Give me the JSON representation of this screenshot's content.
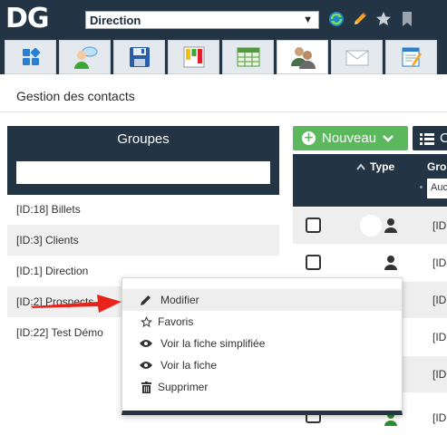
{
  "app": {
    "logo": "DG",
    "group_select": {
      "value": "Direction"
    }
  },
  "header": {
    "icons": [
      "refresh-icon",
      "pencil-icon",
      "star-icon",
      "bookmark-icon"
    ]
  },
  "toolbar": {
    "tabs": [
      {
        "icon": "modules-icon"
      },
      {
        "icon": "user-chat-icon"
      },
      {
        "icon": "floppy-disk-icon"
      },
      {
        "icon": "kanban-board-icon"
      },
      {
        "icon": "table-grid-icon"
      },
      {
        "icon": "contacts-icon",
        "active": true
      },
      {
        "icon": "envelope-icon"
      },
      {
        "icon": "notepad-icon"
      }
    ]
  },
  "page": {
    "title": "Gestion des contacts"
  },
  "groups": {
    "title": "Groupes",
    "search_value": "",
    "items": [
      {
        "label": "[ID:18] Billets"
      },
      {
        "label": "[ID:3] Clients"
      },
      {
        "label": "[ID:1] Direction"
      },
      {
        "label": "[ID:2] Prospects"
      },
      {
        "label": "[ID:22] Test Démo"
      }
    ]
  },
  "contacts": {
    "new_button": "Nouveau",
    "second_button": "C",
    "columns": {
      "type": "Type",
      "group": "Gro",
      "group_filter": "Auc"
    },
    "rows": [
      {
        "id": "[ID"
      },
      {
        "id": "[ID"
      },
      {
        "id": "[ID"
      },
      {
        "id": "[ID"
      },
      {
        "id": "[ID"
      },
      {
        "id": "[ID"
      }
    ]
  },
  "context_menu": {
    "items": [
      {
        "label": "Modifier",
        "icon": "pencil-icon"
      },
      {
        "label": "Favoris",
        "icon": "star-outline-icon"
      },
      {
        "label": "Voir la fiche simplifiée",
        "icon": "eye-icon"
      },
      {
        "label": "Voir la fiche",
        "icon": "eye-icon"
      },
      {
        "label": "Supprimer",
        "icon": "trash-icon"
      }
    ]
  },
  "colors": {
    "navy": "#233445",
    "green": "#5cb85c",
    "red_arrow": "#e8231b"
  }
}
